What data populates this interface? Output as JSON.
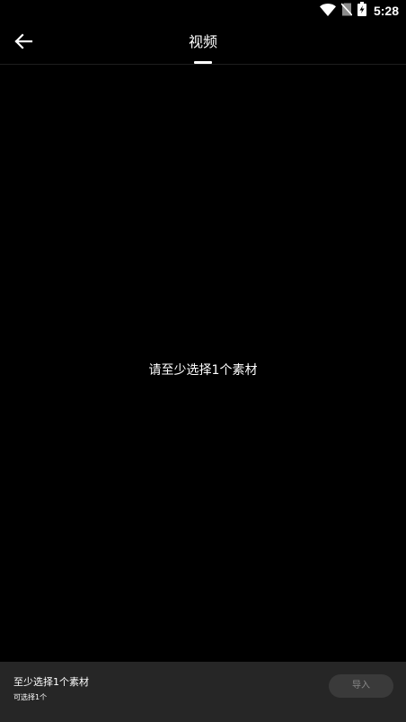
{
  "status_bar": {
    "time": "5:28",
    "icons": [
      "wifi-icon",
      "no-sim-icon",
      "battery-charging-icon"
    ]
  },
  "app_bar": {
    "back_icon": "arrow-left-icon",
    "tabs": [
      {
        "label": "视频",
        "selected": true
      }
    ]
  },
  "content": {
    "empty_hint": "请至少选择1个素材"
  },
  "bottom_bar": {
    "title": "至少选择1个素材",
    "subtitle": "可选择1个",
    "import_label": "导入",
    "import_enabled": false
  },
  "colors": {
    "background": "#000000",
    "bottom_bar": "#262626",
    "button_disabled_bg": "#3a3a3a",
    "button_disabled_text": "#8a8a8a",
    "accent": "#ffffff"
  }
}
